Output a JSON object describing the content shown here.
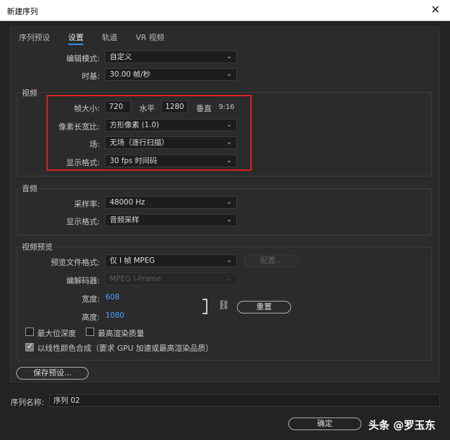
{
  "window": {
    "title": "新建序列"
  },
  "tabs": [
    {
      "label": "序列预设"
    },
    {
      "label": "设置"
    },
    {
      "label": "轨道"
    },
    {
      "label": "VR 视频"
    }
  ],
  "settings": {
    "edit_mode": {
      "label": "编辑模式:",
      "value": "自定义"
    },
    "timebase": {
      "label": "时基:",
      "value": "30.00  帧/秒"
    }
  },
  "video": {
    "group_title": "视频",
    "frame_size": {
      "label": "帧大小:",
      "width": "720",
      "horizontal_label": "水平",
      "height": "1280",
      "vertical_label": "垂直",
      "ratio": "9:16"
    },
    "pixel_aspect": {
      "label": "像素长宽比:",
      "value": "方形像素 (1.0)"
    },
    "fields": {
      "label": "场:",
      "value": "无场（逐行扫描）"
    },
    "display_format": {
      "label": "显示格式:",
      "value": "30 fps 时间码"
    }
  },
  "audio": {
    "group_title": "音频",
    "sample_rate": {
      "label": "采样率:",
      "value": "48000 Hz"
    },
    "display_format": {
      "label": "显示格式:",
      "value": "音频采样"
    }
  },
  "preview": {
    "group_title": "视频预览",
    "file_format": {
      "label": "预览文件格式:",
      "value": "仅 I 帧 MPEG"
    },
    "configure_label": "配置...",
    "codec": {
      "label": "编解码器:",
      "value": "MPEG I-Frame"
    },
    "width": {
      "label": "宽度:",
      "value": "608"
    },
    "height": {
      "label": "高度:",
      "value": "1080"
    },
    "reset_label": "重置",
    "max_bit_depth": {
      "label": "最大位深度",
      "checked": false
    },
    "max_render_quality": {
      "label": "最高渲染质量",
      "checked": false
    },
    "linear_color": {
      "label": "以线性颜色合成（要求 GPU 加速或最高渲染品质）",
      "checked": true
    }
  },
  "save_preset_label": "保存预设...",
  "sequence_name": {
    "label": "序列名称:",
    "value": "序列 02"
  },
  "ok_label": "确定",
  "watermark": "头条 @罗玉东",
  "colors": {
    "accent": "#2d8ceb",
    "highlight_box": "#e02020",
    "link_value": "#4aa3ff"
  },
  "icons": [
    "close-icon",
    "caret-down-icon",
    "link-icon",
    "checkmark-icon"
  ]
}
